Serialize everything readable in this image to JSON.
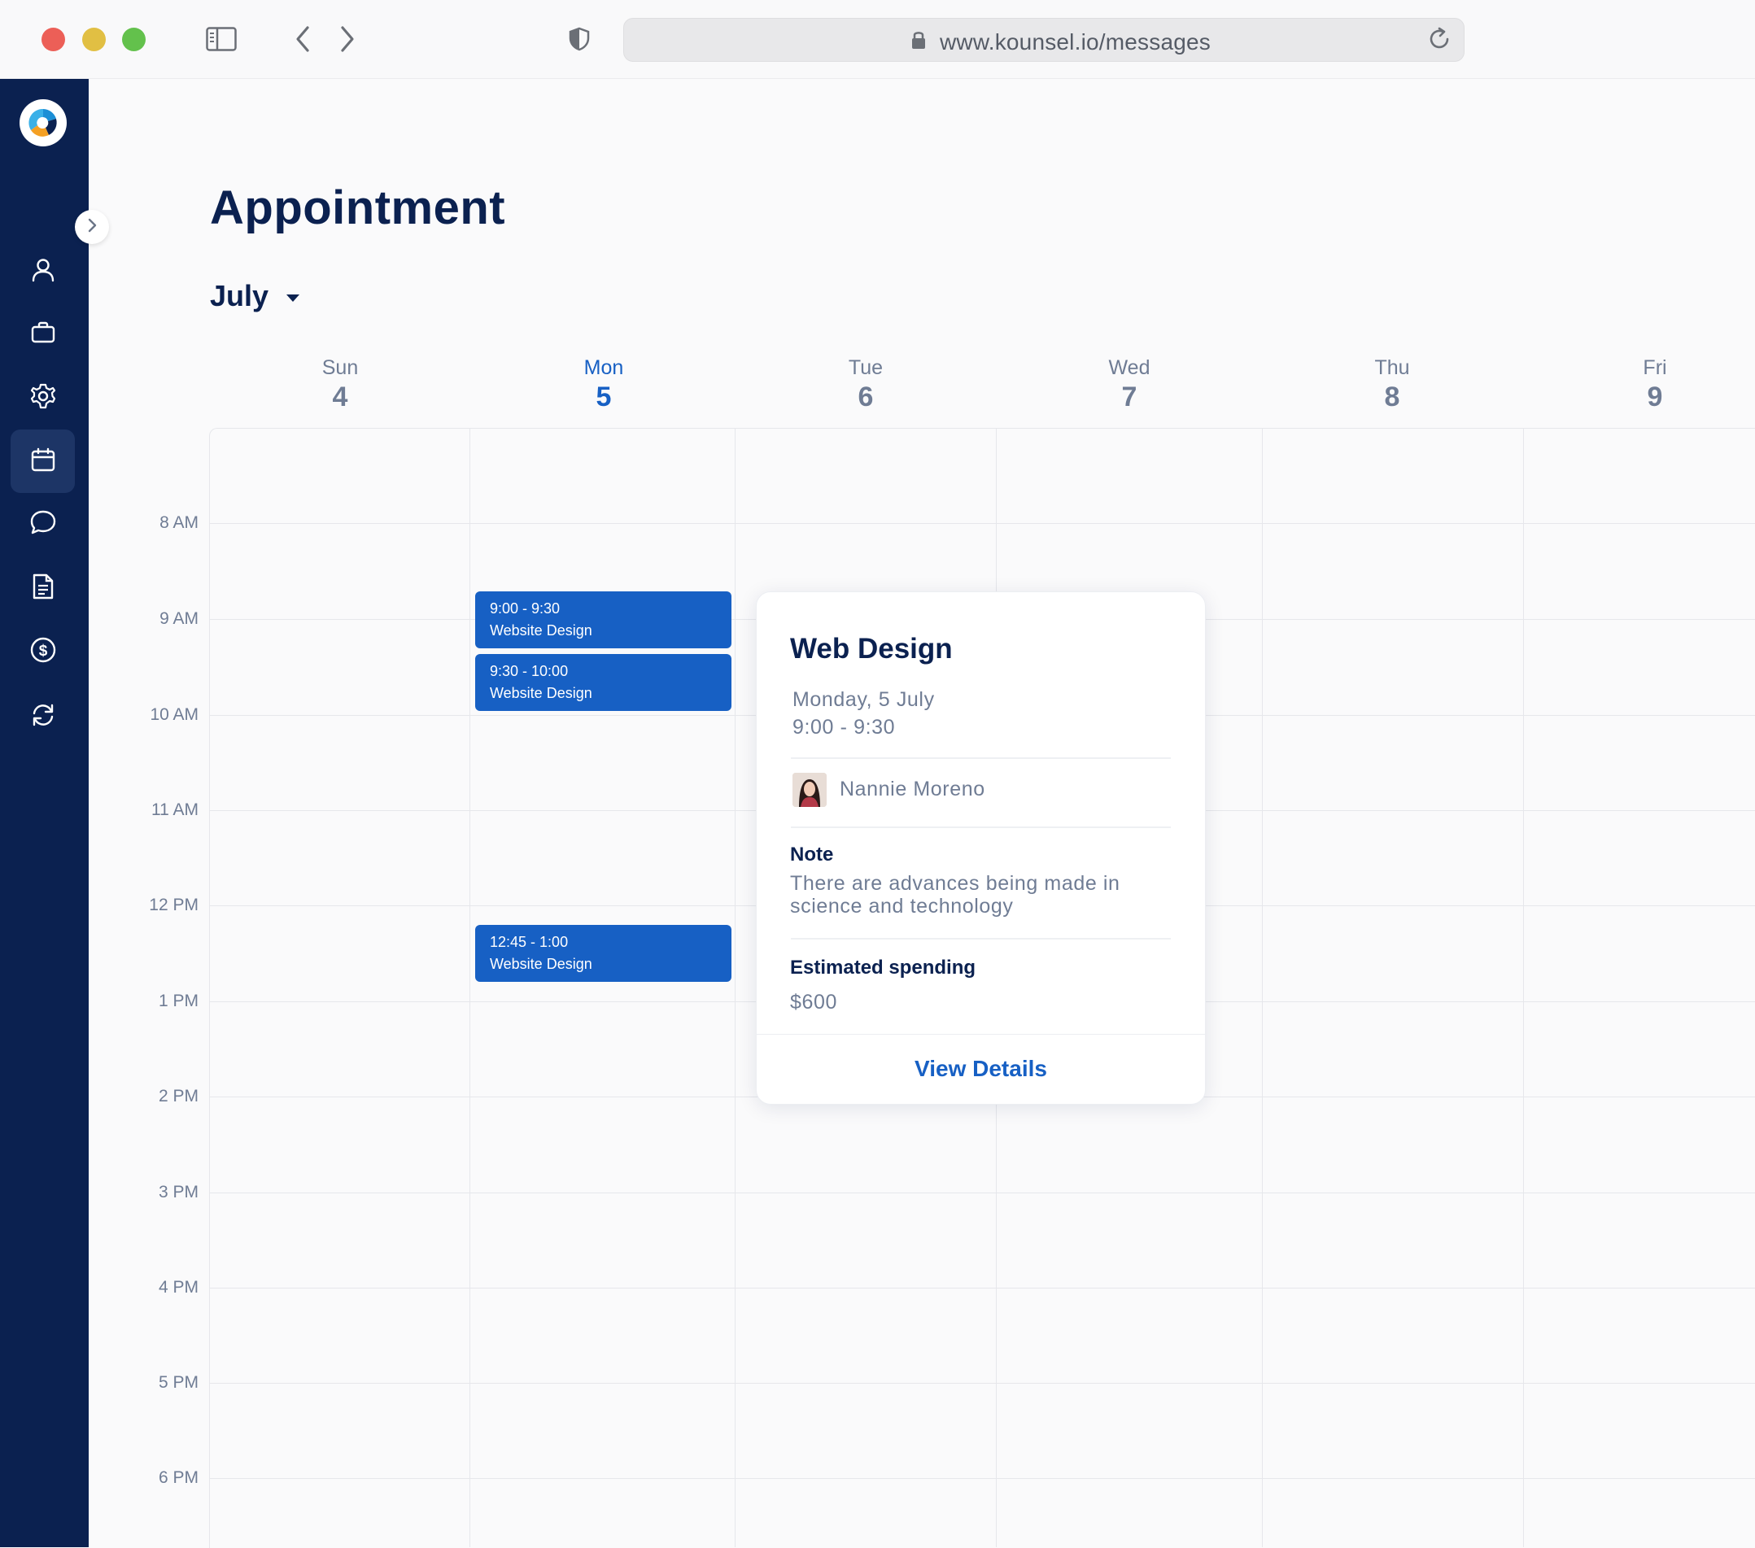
{
  "browser": {
    "url": "www.kounsel.io/messages"
  },
  "sidebar": {
    "items": [
      {
        "icon": "user-icon"
      },
      {
        "icon": "briefcase-icon"
      },
      {
        "icon": "gear-icon"
      },
      {
        "icon": "calendar-icon",
        "active": true
      },
      {
        "icon": "chat-icon"
      },
      {
        "icon": "document-icon"
      },
      {
        "icon": "dollar-icon"
      },
      {
        "icon": "sync-icon"
      }
    ]
  },
  "page": {
    "title": "Appointment",
    "month": "July"
  },
  "calendar": {
    "days": [
      {
        "name": "Sun",
        "num": "4"
      },
      {
        "name": "Mon",
        "num": "5",
        "active": true
      },
      {
        "name": "Tue",
        "num": "6"
      },
      {
        "name": "Wed",
        "num": "7"
      },
      {
        "name": "Thu",
        "num": "8"
      },
      {
        "name": "Fri",
        "num": "9"
      }
    ],
    "times": [
      "8 AM",
      "9 AM",
      "10 AM",
      "11 AM",
      "12 PM",
      "1 PM",
      "2 PM",
      "3 PM",
      "4 PM",
      "5 PM",
      "6 PM"
    ],
    "events": [
      {
        "time": "9:00 - 9:30",
        "title": "Website Design"
      },
      {
        "time": "9:30 - 10:00",
        "title": "Website Design"
      },
      {
        "time": "12:45 - 1:00",
        "title": "Website Design"
      }
    ]
  },
  "popup": {
    "title": "Web Design",
    "date": "Monday, 5 July",
    "time": "9:00 - 9:30",
    "person": "Nannie Moreno",
    "note_label": "Note",
    "note": "There are advances being made in science and technology",
    "spending_label": "Estimated spending",
    "spending": "$600",
    "link": "View Details"
  },
  "colors": {
    "sidebar": "#0b2150",
    "accent": "#1760c4",
    "muted": "#6f7c94"
  }
}
